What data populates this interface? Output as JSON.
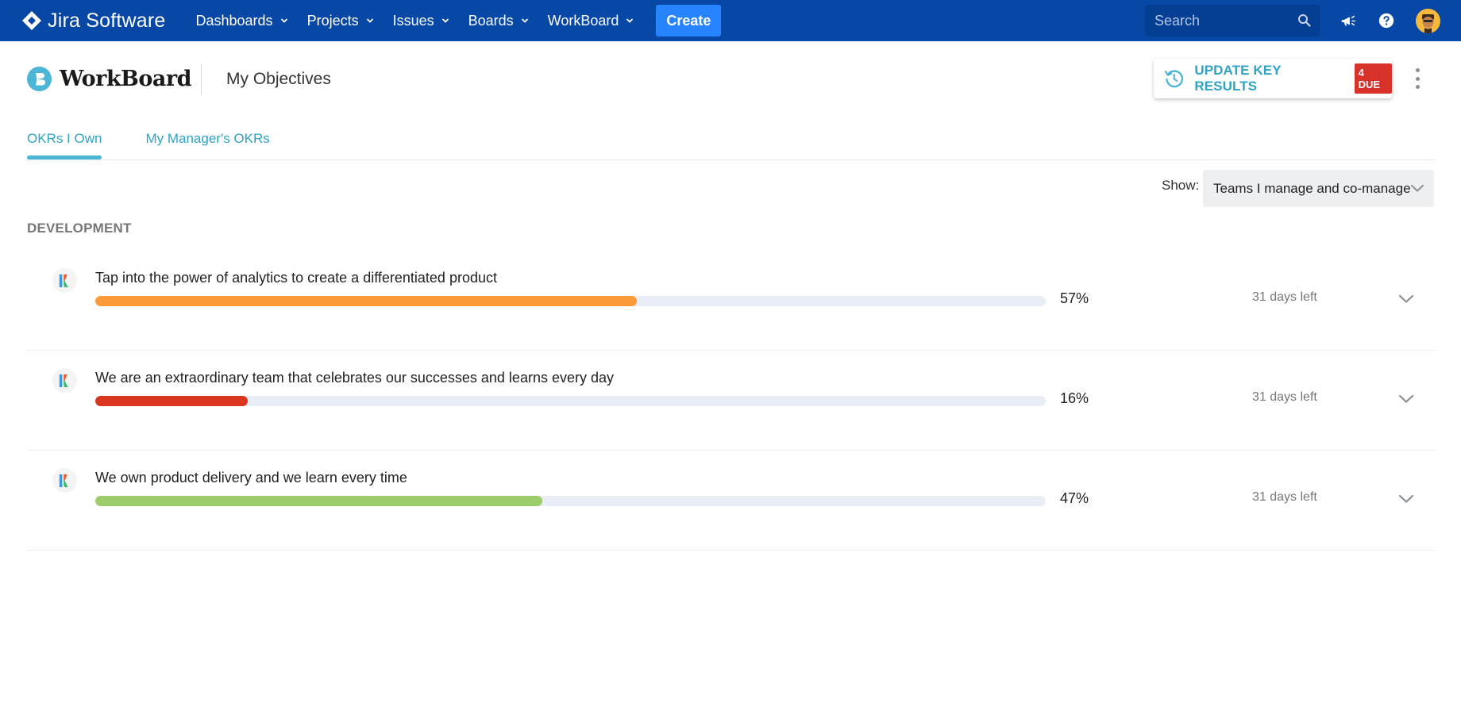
{
  "topnav": {
    "product_name": "Jira Software",
    "items": [
      {
        "label": "Dashboards"
      },
      {
        "label": "Projects"
      },
      {
        "label": "Issues"
      },
      {
        "label": "Boards"
      },
      {
        "label": "WorkBoard"
      }
    ],
    "create_label": "Create",
    "search_placeholder": "Search",
    "brand_color": "#0747a6",
    "icons": [
      "jira-logo-icon",
      "search-icon",
      "notifications-megaphone-icon",
      "help-icon",
      "user-avatar"
    ]
  },
  "header": {
    "app_name": "WorkBoard",
    "page_title": "My Objectives",
    "update_button_label": "UPDATE KEY RESULTS",
    "due_badge": "4 DUE",
    "accent_color": "#2fa3c5"
  },
  "tabs": [
    {
      "label": "OKRs I Own",
      "active": true
    },
    {
      "label": "My Manager's OKRs",
      "active": false
    }
  ],
  "filter": {
    "label": "Show:",
    "selected": "Teams I manage and co-manage"
  },
  "section": {
    "title": "DEVELOPMENT"
  },
  "objectives": [
    {
      "title": "Tap into the power of analytics to create a differentiated product",
      "percent_label": "57%",
      "progress": 0.57,
      "days_left": "31 days left",
      "color": "#fa9a38"
    },
    {
      "title": "We are an extraordinary team that celebrates our successes and learns every day",
      "percent_label": "16%",
      "progress": 0.16,
      "days_left": "31 days left",
      "color": "#d9351f"
    },
    {
      "title": "We own product delivery and we learn every time",
      "percent_label": "47%",
      "progress": 0.47,
      "days_left": "31 days left",
      "color": "#9dcc6b"
    }
  ]
}
